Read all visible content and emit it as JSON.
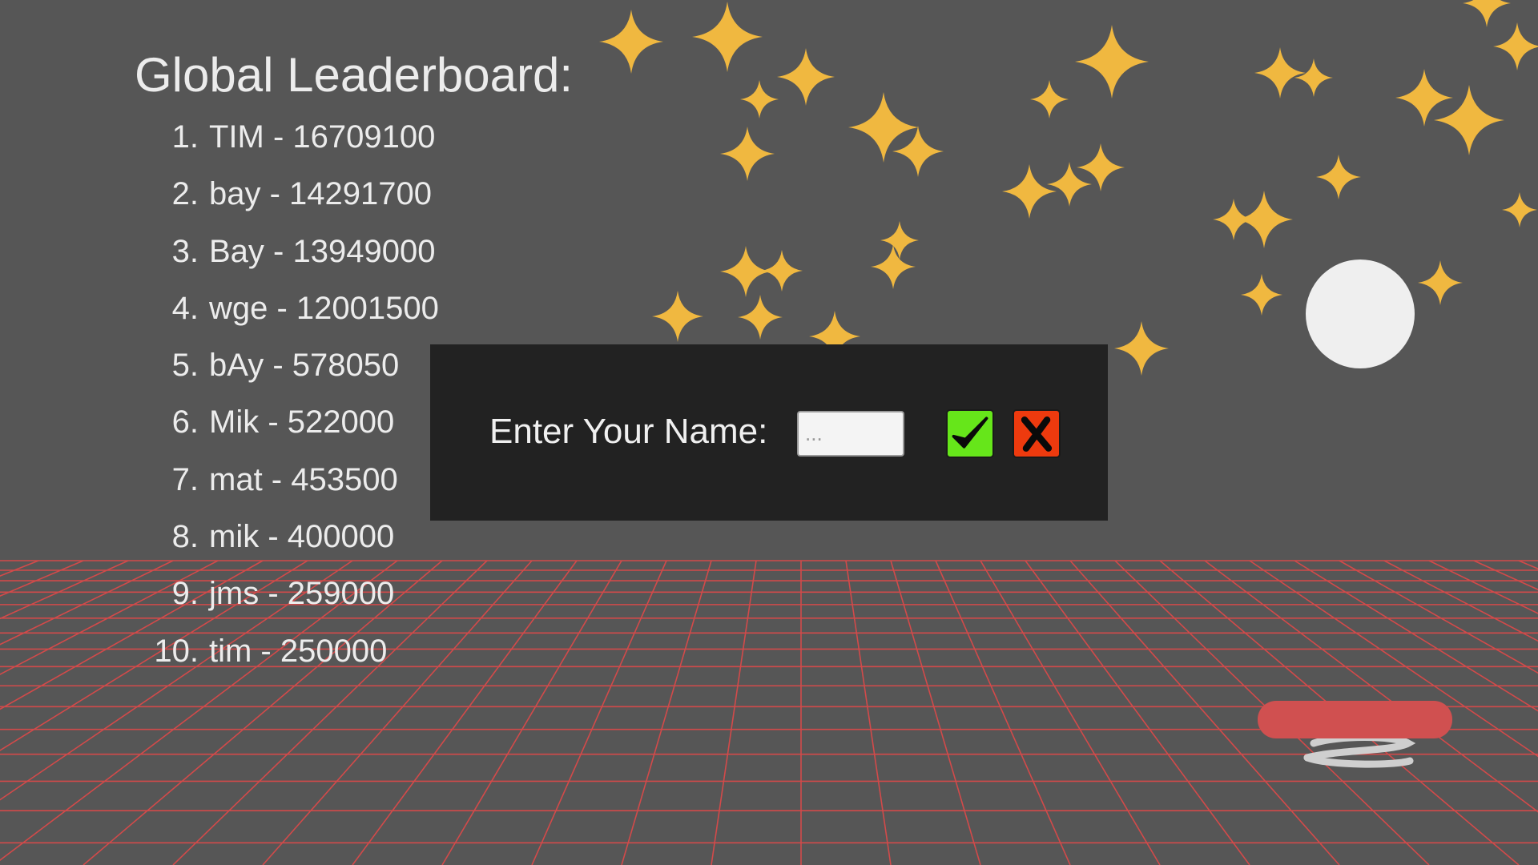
{
  "leaderboard": {
    "title": "Global Leaderboard:",
    "entries": [
      {
        "rank": "1.",
        "text": "TIM - 16709100"
      },
      {
        "rank": "2.",
        "text": "bay - 14291700"
      },
      {
        "rank": "3.",
        "text": "Bay - 13949000"
      },
      {
        "rank": "4.",
        "text": "wge - 12001500"
      },
      {
        "rank": "5.",
        "text": "bAy - 578050"
      },
      {
        "rank": "6.",
        "text": "Mik - 522000"
      },
      {
        "rank": "7.",
        "text": "mat - 453500"
      },
      {
        "rank": "8.",
        "text": "mik - 400000"
      },
      {
        "rank": "9.",
        "text": "jms - 259000"
      },
      {
        "rank": "10.",
        "text": "tim - 250000"
      }
    ]
  },
  "dialog": {
    "label": "Enter Your Name:",
    "input_value": "",
    "input_placeholder": "...",
    "confirm_icon": "checkmark-icon",
    "cancel_icon": "x-icon"
  },
  "colors": {
    "background": "#565656",
    "star": "#f0b840",
    "grid_line": "#d24a4a",
    "dialog_bg": "#222222",
    "confirm": "#66e61a",
    "cancel": "#ee3a0e",
    "paddle": "#d05050",
    "ball": "#efefef"
  }
}
